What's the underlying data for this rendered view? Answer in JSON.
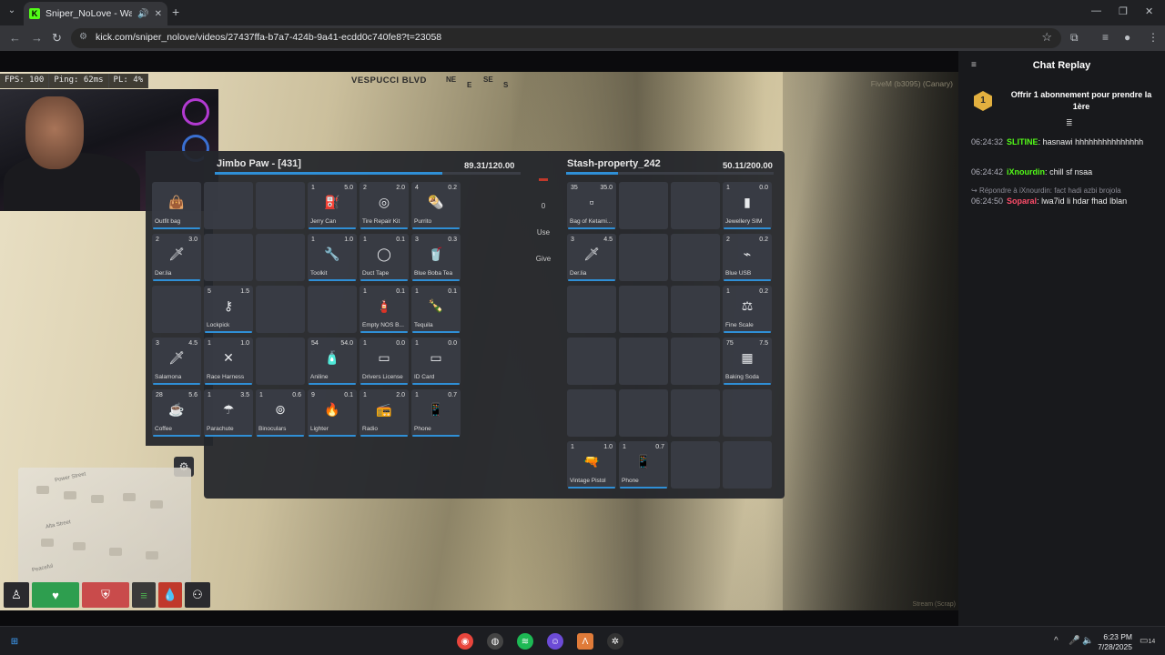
{
  "browser": {
    "tab_title": "Sniper_NoLove - Watch the",
    "tab_favicon": "K",
    "url": "kick.com/sniper_nolove/videos/27437ffa-b7a7-424b-9a41-ecdd0c740fe8?t=23058"
  },
  "hud": {
    "fps": "FPS: 100",
    "ping": "Ping: 62ms",
    "pl": "PL: 4%",
    "street": "VESPUCCI BLVD",
    "compass": [
      "NE",
      "E",
      "SE",
      "S"
    ],
    "server": "FiveM (b3095) (Canary)",
    "watermark": "Stream (Scrap)"
  },
  "inventory_left": {
    "title": "Jimbo Paw - [431]",
    "weight": "89.31/120.00",
    "weight_fraction": 0.744
  },
  "inventory_right": {
    "title": "Stash-property_242",
    "weight": "50.11/200.00",
    "weight_fraction": 0.25
  },
  "middle_actions": {
    "amount": "0",
    "use": "Use",
    "give": "Give"
  },
  "left_slots": [
    {
      "count": "",
      "weight": "",
      "label": "Outfit bag",
      "icon": "bag"
    },
    {
      "count": "2",
      "weight": "3.0",
      "label": "Der.lia",
      "icon": "knife"
    },
    {
      "count": "",
      "weight": "",
      "label": "",
      "icon": ""
    },
    {
      "count": "3",
      "weight": "4.5",
      "label": "Salamona",
      "icon": "knife"
    },
    {
      "count": "28",
      "weight": "5.6",
      "label": "Coffee",
      "icon": "cup"
    },
    {
      "count": "",
      "weight": "",
      "label": "",
      "icon": ""
    },
    {
      "count": "",
      "weight": "",
      "label": "",
      "icon": ""
    },
    {
      "count": "5",
      "weight": "1.5",
      "label": "Lockpick",
      "icon": "lockpick"
    },
    {
      "count": "1",
      "weight": "1.0",
      "label": "Race Harness",
      "icon": "harness"
    },
    {
      "count": "1",
      "weight": "3.5",
      "label": "Parachute",
      "icon": "parachute"
    },
    {
      "count": "",
      "weight": "",
      "label": "",
      "icon": ""
    },
    {
      "count": "",
      "weight": "",
      "label": "",
      "icon": ""
    },
    {
      "count": "",
      "weight": "",
      "label": "",
      "icon": ""
    },
    {
      "count": "",
      "weight": "",
      "label": "",
      "icon": ""
    },
    {
      "count": "1",
      "weight": "0.6",
      "label": "Binoculars",
      "icon": "binoculars"
    },
    {
      "count": "1",
      "weight": "5.0",
      "label": "Jerry Can",
      "icon": "jerrycan"
    },
    {
      "count": "1",
      "weight": "1.0",
      "label": "Toolkit",
      "icon": "toolkit"
    },
    {
      "count": "",
      "weight": "",
      "label": "",
      "icon": ""
    },
    {
      "count": "54",
      "weight": "54.0",
      "label": "Aniline",
      "icon": "bottle"
    },
    {
      "count": "9",
      "weight": "0.1",
      "label": "Lighter",
      "icon": "lighter"
    },
    {
      "count": "2",
      "weight": "2.0",
      "label": "Tire Repair Kit",
      "icon": "tire"
    },
    {
      "count": "1",
      "weight": "0.1",
      "label": "Duct Tape",
      "icon": "tape"
    },
    {
      "count": "1",
      "weight": "0.1",
      "label": "Empty NOS B...",
      "icon": "nos"
    },
    {
      "count": "1",
      "weight": "0.0",
      "label": "Drivers License",
      "icon": "card"
    },
    {
      "count": "1",
      "weight": "2.0",
      "label": "Radio",
      "icon": "radio"
    },
    {
      "count": "4",
      "weight": "0.2",
      "label": "Purrito",
      "icon": "burrito"
    },
    {
      "count": "3",
      "weight": "0.3",
      "label": "Blue Boba Tea",
      "icon": "boba"
    },
    {
      "count": "1",
      "weight": "0.1",
      "label": "Tequila",
      "icon": "tequila"
    },
    {
      "count": "1",
      "weight": "0.0",
      "label": "ID Card",
      "icon": "card"
    },
    {
      "count": "1",
      "weight": "0.7",
      "label": "Phone",
      "icon": "phone"
    }
  ],
  "right_slots": [
    {
      "count": "35",
      "weight": "35.0",
      "label": "Bag of Ketami...",
      "icon": "baggie"
    },
    {
      "count": "3",
      "weight": "4.5",
      "label": "Der.lia",
      "icon": "knife"
    },
    {
      "count": "",
      "weight": "",
      "label": "",
      "icon": ""
    },
    {
      "count": "",
      "weight": "",
      "label": "",
      "icon": ""
    },
    {
      "count": "",
      "weight": "",
      "label": "",
      "icon": ""
    },
    {
      "count": "1",
      "weight": "1.0",
      "label": "Vintage Pistol",
      "icon": "pistol"
    },
    {
      "count": "",
      "weight": "",
      "label": "",
      "icon": ""
    },
    {
      "count": "",
      "weight": "",
      "label": "",
      "icon": ""
    },
    {
      "count": "",
      "weight": "",
      "label": "",
      "icon": ""
    },
    {
      "count": "",
      "weight": "",
      "label": "",
      "icon": ""
    },
    {
      "count": "",
      "weight": "",
      "label": "",
      "icon": ""
    },
    {
      "count": "1",
      "weight": "0.7",
      "label": "Phone",
      "icon": "phone"
    },
    {
      "count": "",
      "weight": "",
      "label": "",
      "icon": ""
    },
    {
      "count": "",
      "weight": "",
      "label": "",
      "icon": ""
    },
    {
      "count": "",
      "weight": "",
      "label": "",
      "icon": ""
    },
    {
      "count": "",
      "weight": "",
      "label": "",
      "icon": ""
    },
    {
      "count": "",
      "weight": "",
      "label": "",
      "icon": ""
    },
    {
      "count": "",
      "weight": "",
      "label": "",
      "icon": ""
    },
    {
      "count": "1",
      "weight": "0.0",
      "label": "Jewellery SIM",
      "icon": "sim"
    },
    {
      "count": "2",
      "weight": "0.2",
      "label": "Blue USB",
      "icon": "usb"
    },
    {
      "count": "1",
      "weight": "0.2",
      "label": "Fine Scale",
      "icon": "scale"
    },
    {
      "count": "75",
      "weight": "7.5",
      "label": "Baking Soda",
      "icon": "soda"
    },
    {
      "count": "",
      "weight": "",
      "label": "",
      "icon": ""
    },
    {
      "count": "",
      "weight": "",
      "label": "",
      "icon": ""
    }
  ],
  "minimap": {
    "streets": [
      "Power Street",
      "Alta Street",
      "Peaceful"
    ],
    "blocks": [
      "8141",
      "8143",
      "8145",
      "8151",
      "8153",
      "8155",
      "8157",
      "8159",
      "8160"
    ]
  },
  "chat": {
    "title": "Chat Replay",
    "sub_badge": "1",
    "sub_text": "Offrir 1 abonnement pour prendre la 1ère",
    "messages": [
      {
        "time": "06:24:32",
        "user": "SLITINE",
        "text": "hasnawi hhhhhhhhhhhhhhh",
        "color": "#53fc18"
      },
      {
        "time": "06:24:42",
        "user": "iXnourdin",
        "text": "chill sf nsaa",
        "color": "#53fc18"
      },
      {
        "time": "06:24:50",
        "user": "Soparal",
        "text": "lwa7id li hdar fhad lblan",
        "color": "#ff4d6a"
      }
    ],
    "reply_hint": "Répondre à iXnourdin: fact hadi azbi brojola"
  },
  "taskbar": {
    "time": "6:23 PM",
    "date": "7/28/2025",
    "notif_count": "14"
  },
  "colors": {
    "accent": "#2f8fd6",
    "kick_green": "#53fc18",
    "health": "#2e9e4f",
    "armor": "#c94b4b"
  }
}
